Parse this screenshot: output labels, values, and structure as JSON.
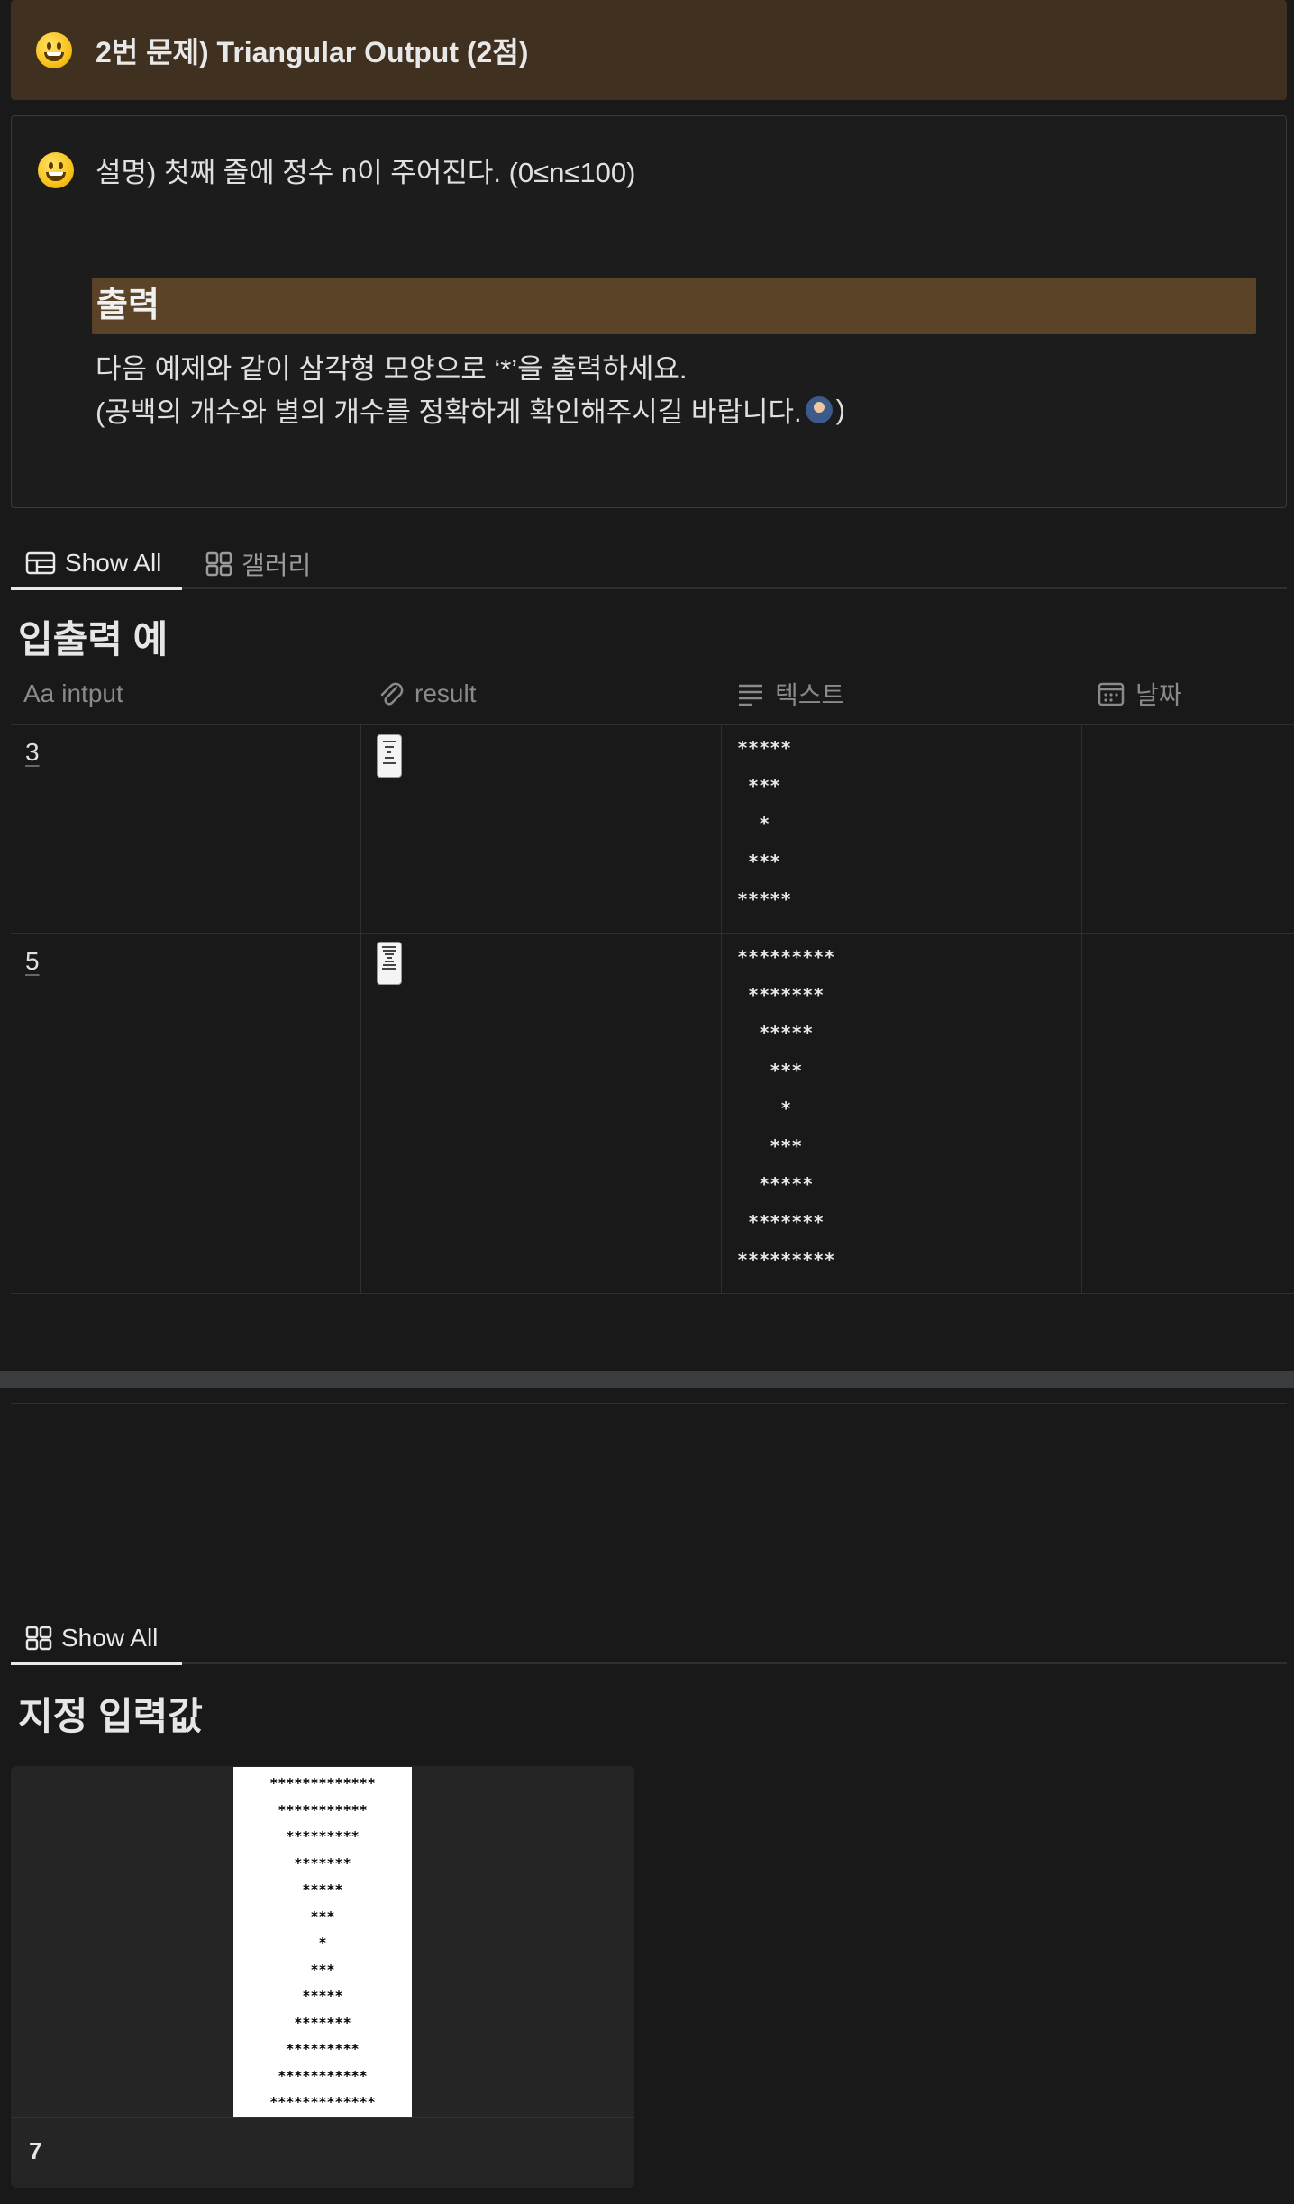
{
  "title_callout": {
    "icon": "grinning-face-emoji",
    "text": "2번 문제) Triangular Output (2점)"
  },
  "description": {
    "icon": "grinning-face-emoji",
    "text": "설명) 첫째 줄에 정수 n이 주어진다. (0≤n≤100)",
    "output_heading": "출력",
    "output_line1": "다음 예제와 같이 삼각형 모양으로 ‘*’을 출력하세요.",
    "output_line2_before": "(공백의 개수와 별의 개수를 정확하게 확인해주시길 바랍니다.",
    "output_line2_after": ")"
  },
  "tabs1": [
    {
      "label": "Show All",
      "icon": "table-icon",
      "active": true
    },
    {
      "label": "갤러리",
      "icon": "gallery-icon",
      "active": false
    }
  ],
  "section1_title": "입출력 예",
  "table": {
    "headers": [
      {
        "label": "intput",
        "icon": "Aa"
      },
      {
        "label": "result",
        "icon": "paperclip-icon"
      },
      {
        "label": "텍스트",
        "icon": "text-lines-icon"
      },
      {
        "label": "날짜",
        "icon": "calendar-icon"
      }
    ],
    "rows": [
      {
        "input": "3",
        "text": "*****\n ***\n  *\n ***\n*****",
        "date": ""
      },
      {
        "input": "5",
        "text": "*********\n *******\n  *****\n   ***\n    *\n   ***\n  *****\n *******\n*********",
        "date": ""
      }
    ]
  },
  "tabs2": [
    {
      "label": "Show All",
      "icon": "gallery-icon",
      "active": true
    }
  ],
  "section2_title": "지정 입력값",
  "gallery_card": {
    "image_text": "*************\n***********\n*********\n*******\n*****\n***\n*\n***\n*****\n*******\n*********\n***********\n*************",
    "title": "7"
  },
  "colors": {
    "background": "#191919",
    "title_callout_bg": "#3f3020",
    "heading_bg": "#5a4326",
    "separator": "#393d40"
  }
}
